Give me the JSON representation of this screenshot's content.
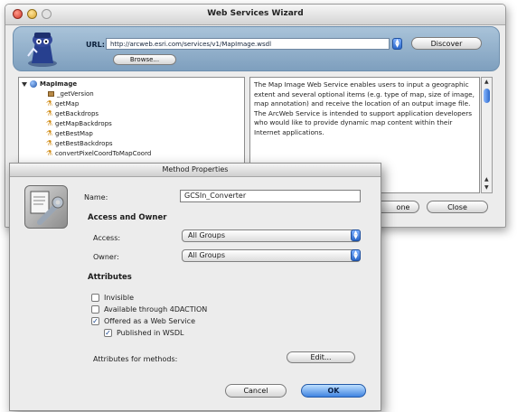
{
  "wizard": {
    "title": "Web Services Wizard",
    "url_label": "URL:",
    "url_value": "http://arcweb.esri.com/services/v1/MapImage.wsdl",
    "discover_label": "Discover",
    "browse_label": "Browse...",
    "tree": [
      {
        "label": "MapImage",
        "kind": "service"
      },
      {
        "label": "_getVersion",
        "kind": "doc"
      },
      {
        "label": "getMap",
        "kind": "method"
      },
      {
        "label": "getBackdrops",
        "kind": "method"
      },
      {
        "label": "getMapBackdrops",
        "kind": "method"
      },
      {
        "label": "getBestMap",
        "kind": "method"
      },
      {
        "label": "getBestBackdrops",
        "kind": "method"
      },
      {
        "label": "convertPixelCoordToMapCoord",
        "kind": "method"
      }
    ],
    "description": "The Map Image Web Service enables users to input a geographic extent and several optional items (e.g. type of map, size of image, map annotation) and receive the location of an output image file. The ArcWeb Service is intended to support application developers who would like to provide dynamic map content within their Internet applications.",
    "close_label": "Close",
    "partial_button_label": "one"
  },
  "method_properties": {
    "title": "Method Properties",
    "name_label": "Name:",
    "name_value": "GCSIn_Converter",
    "access_section": "Access and Owner",
    "access_label": "Access:",
    "access_value": "All Groups",
    "owner_label": "Owner:",
    "owner_value": "All Groups",
    "attributes_section": "Attributes",
    "checkboxes": [
      {
        "label": "Invisible",
        "checked": false
      },
      {
        "label": "Available through 4DACTION",
        "checked": false
      },
      {
        "label": "Offered as a Web Service",
        "checked": true
      },
      {
        "label": "Published in WSDL",
        "checked": true
      }
    ],
    "attributes_for_methods_label": "Attributes for methods:",
    "edit_label": "Edit...",
    "cancel_label": "Cancel",
    "ok_label": "OK"
  },
  "colors": {
    "url_band": "#8fb0cf",
    "default_button": "#3f83e0",
    "close_light": "#d0362a",
    "minimize_light": "#d9a42c"
  }
}
